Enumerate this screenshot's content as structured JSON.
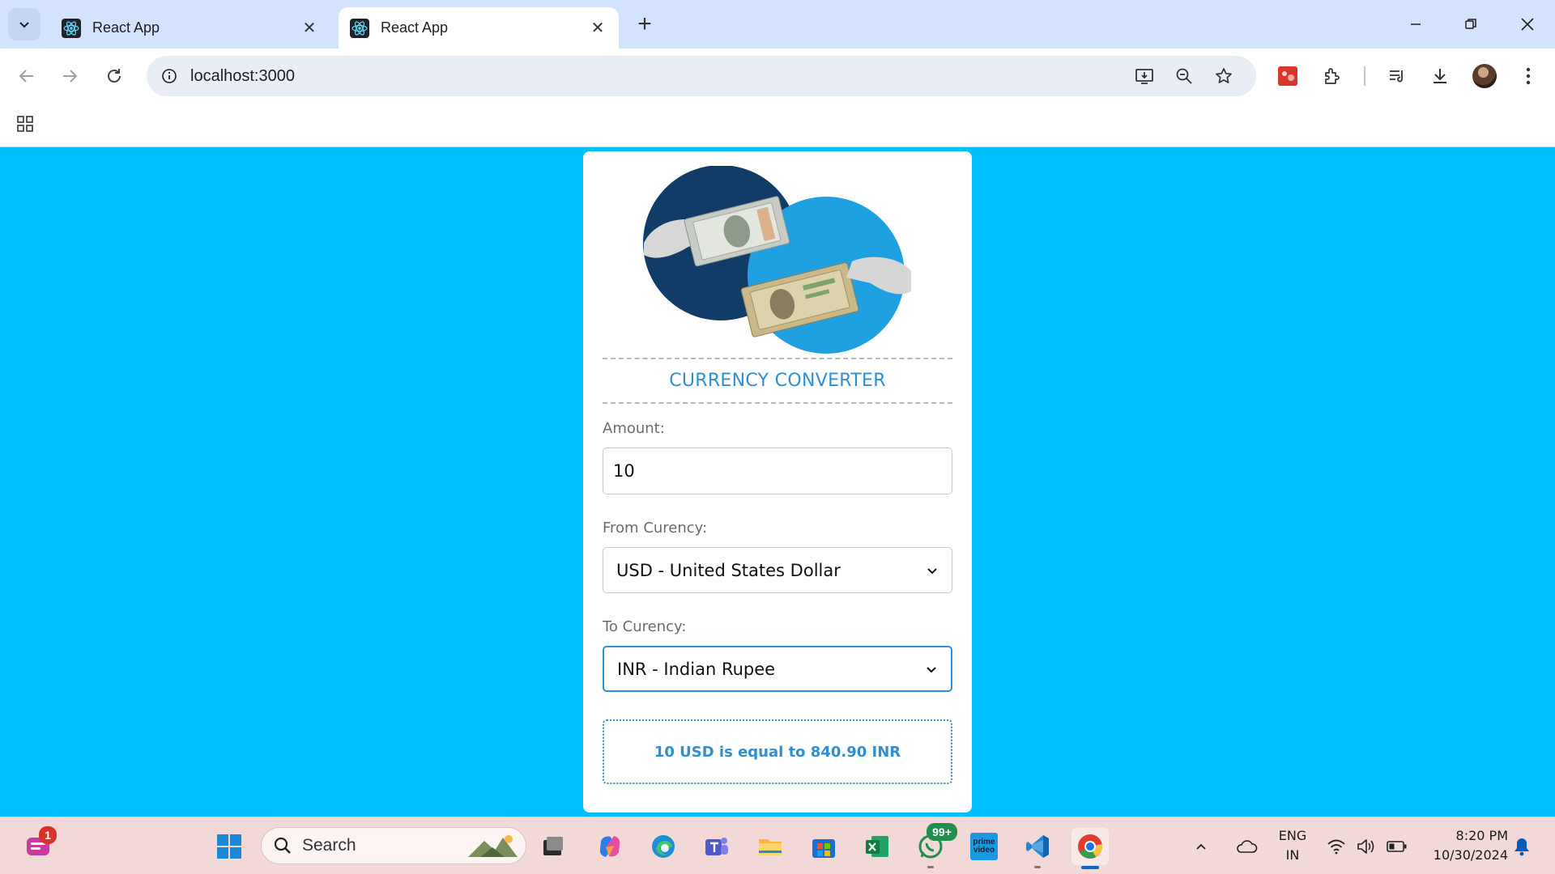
{
  "browser": {
    "tabs": [
      {
        "title": "React App",
        "active": false
      },
      {
        "title": "React App",
        "active": true
      }
    ],
    "address": "localhost:3000"
  },
  "app": {
    "title": "CURRENCY CONVERTER",
    "amount_label": "Amount:",
    "amount_value": "10",
    "from_label": "From Curency:",
    "from_value": "USD - United States Dollar",
    "to_label": "To Curency:",
    "to_value": "INR - Indian Rupee",
    "result": "10 USD is equal to 840.90 INR"
  },
  "taskbar": {
    "search_placeholder": "Search",
    "copilot_badge": "1",
    "whatsapp_badge": "99+",
    "prime_label": "prime video",
    "language_line1": "ENG",
    "language_line2": "IN",
    "time": "8:20 PM",
    "date": "10/30/2024"
  },
  "colors": {
    "page_background": "#00bfff",
    "accent": "#2f8fd0",
    "tabbar": "#d3e3fd",
    "taskbar": "#f2d9d8"
  }
}
